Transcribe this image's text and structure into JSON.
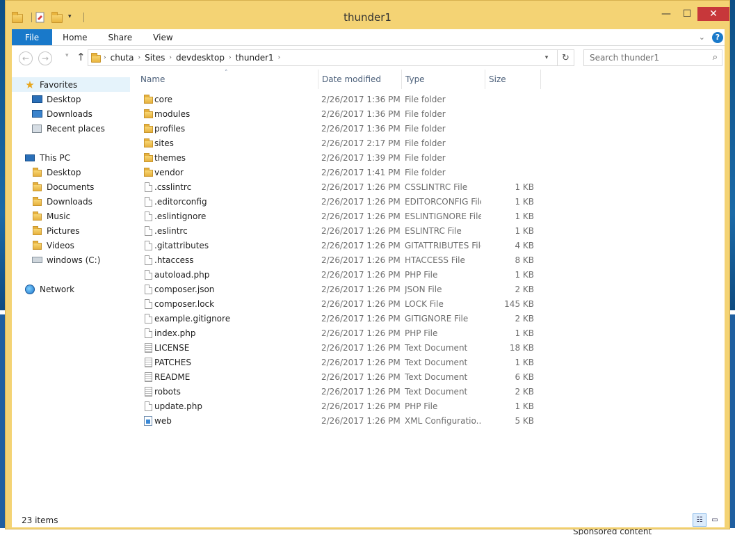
{
  "window": {
    "title": "thunder1",
    "minimize_glyph": "—",
    "maximize_glyph": "☐",
    "close_glyph": "✕"
  },
  "ribbon": {
    "tabs": [
      "File",
      "Home",
      "Share",
      "View"
    ],
    "help_glyph": "?",
    "collapse_glyph": "⌄"
  },
  "nav": {
    "back_glyph": "←",
    "forward_glyph": "→",
    "recent_glyph": "▾",
    "up_glyph": "↑"
  },
  "address": {
    "crumbs": [
      "chuta",
      "Sites",
      "devdesktop",
      "thunder1"
    ],
    "separator_glyph": "›",
    "dropdown_glyph": "▾",
    "refresh_glyph": "↻"
  },
  "search": {
    "placeholder": "Search thunder1",
    "icon_glyph": "⌕"
  },
  "sidebar": {
    "favorites_label": "Favorites",
    "favorites": [
      "Desktop",
      "Downloads",
      "Recent places"
    ],
    "thispc_label": "This PC",
    "thispc": [
      "Desktop",
      "Documents",
      "Downloads",
      "Music",
      "Pictures",
      "Videos",
      "windows (C:)"
    ],
    "network_label": "Network",
    "star_glyph": "★",
    "music_glyph": "♪",
    "download_glyph": "⬇"
  },
  "columns": {
    "name": "Name",
    "date": "Date modified",
    "type": "Type",
    "size": "Size",
    "sort_glyph": "˄"
  },
  "files": [
    {
      "name": "core",
      "date": "2/26/2017 1:36 PM",
      "type": "File folder",
      "size": "",
      "kind": "folder"
    },
    {
      "name": "modules",
      "date": "2/26/2017 1:36 PM",
      "type": "File folder",
      "size": "",
      "kind": "folder"
    },
    {
      "name": "profiles",
      "date": "2/26/2017 1:36 PM",
      "type": "File folder",
      "size": "",
      "kind": "folder"
    },
    {
      "name": "sites",
      "date": "2/26/2017 2:17 PM",
      "type": "File folder",
      "size": "",
      "kind": "folder"
    },
    {
      "name": "themes",
      "date": "2/26/2017 1:39 PM",
      "type": "File folder",
      "size": "",
      "kind": "folder"
    },
    {
      "name": "vendor",
      "date": "2/26/2017 1:41 PM",
      "type": "File folder",
      "size": "",
      "kind": "folder"
    },
    {
      "name": ".csslintrc",
      "date": "2/26/2017 1:26 PM",
      "type": "CSSLINTRC File",
      "size": "1 KB",
      "kind": "file"
    },
    {
      "name": ".editorconfig",
      "date": "2/26/2017 1:26 PM",
      "type": "EDITORCONFIG File",
      "size": "1 KB",
      "kind": "file"
    },
    {
      "name": ".eslintignore",
      "date": "2/26/2017 1:26 PM",
      "type": "ESLINTIGNORE File",
      "size": "1 KB",
      "kind": "file"
    },
    {
      "name": ".eslintrc",
      "date": "2/26/2017 1:26 PM",
      "type": "ESLINTRC File",
      "size": "1 KB",
      "kind": "file"
    },
    {
      "name": ".gitattributes",
      "date": "2/26/2017 1:26 PM",
      "type": "GITATTRIBUTES File",
      "size": "4 KB",
      "kind": "file"
    },
    {
      "name": ".htaccess",
      "date": "2/26/2017 1:26 PM",
      "type": "HTACCESS File",
      "size": "8 KB",
      "kind": "file"
    },
    {
      "name": "autoload.php",
      "date": "2/26/2017 1:26 PM",
      "type": "PHP File",
      "size": "1 KB",
      "kind": "file"
    },
    {
      "name": "composer.json",
      "date": "2/26/2017 1:26 PM",
      "type": "JSON File",
      "size": "2 KB",
      "kind": "file"
    },
    {
      "name": "composer.lock",
      "date": "2/26/2017 1:26 PM",
      "type": "LOCK File",
      "size": "145 KB",
      "kind": "file"
    },
    {
      "name": "example.gitignore",
      "date": "2/26/2017 1:26 PM",
      "type": "GITIGNORE File",
      "size": "2 KB",
      "kind": "file"
    },
    {
      "name": "index.php",
      "date": "2/26/2017 1:26 PM",
      "type": "PHP File",
      "size": "1 KB",
      "kind": "file"
    },
    {
      "name": "LICENSE",
      "date": "2/26/2017 1:26 PM",
      "type": "Text Document",
      "size": "18 KB",
      "kind": "text"
    },
    {
      "name": "PATCHES",
      "date": "2/26/2017 1:26 PM",
      "type": "Text Document",
      "size": "1 KB",
      "kind": "text"
    },
    {
      "name": "README",
      "date": "2/26/2017 1:26 PM",
      "type": "Text Document",
      "size": "6 KB",
      "kind": "text"
    },
    {
      "name": "robots",
      "date": "2/26/2017 1:26 PM",
      "type": "Text Document",
      "size": "2 KB",
      "kind": "text"
    },
    {
      "name": "update.php",
      "date": "2/26/2017 1:26 PM",
      "type": "PHP File",
      "size": "1 KB",
      "kind": "file"
    },
    {
      "name": "web",
      "date": "2/26/2017 1:26 PM",
      "type": "XML Configuratio...",
      "size": "5 KB",
      "kind": "xml"
    }
  ],
  "status": {
    "count": "23 items",
    "details_glyph": "☷",
    "icons_glyph": "▭"
  },
  "desktop": {
    "behind_text": "Sponsored content"
  }
}
